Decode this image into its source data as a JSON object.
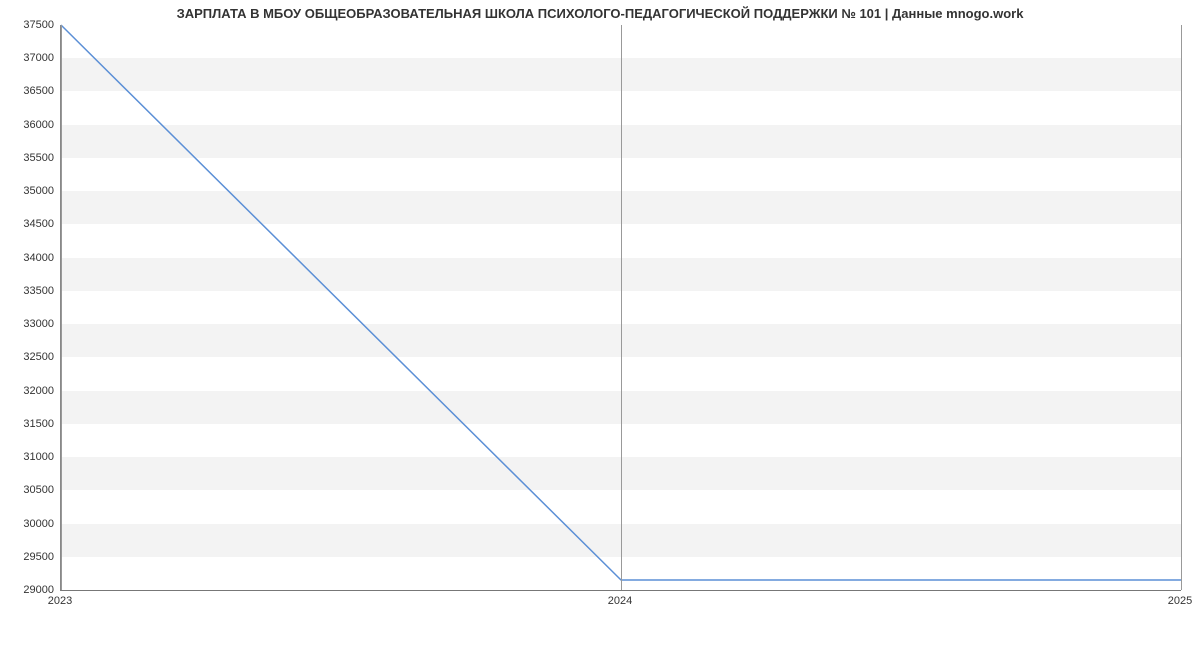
{
  "chart_data": {
    "type": "line",
    "title": "ЗАРПЛАТА В МБОУ ОБЩЕОБРАЗОВАТЕЛЬНАЯ ШКОЛА ПСИХОЛОГО-ПЕДАГОГИЧЕСКОЙ ПОДДЕРЖКИ № 101 | Данные mnogo.work",
    "x": [
      2023,
      2024,
      2025
    ],
    "values": [
      37500,
      29150,
      29150
    ],
    "x_ticks": [
      2023,
      2024,
      2025
    ],
    "y_ticks": [
      29000,
      29500,
      30000,
      30500,
      31000,
      31500,
      32000,
      32500,
      33000,
      33500,
      34000,
      34500,
      35000,
      35500,
      36000,
      36500,
      37000,
      37500
    ],
    "xlim": [
      2023,
      2025
    ],
    "ylim": [
      29000,
      37500
    ],
    "xlabel": "",
    "ylabel": "",
    "line_color": "#5b8fd6"
  }
}
